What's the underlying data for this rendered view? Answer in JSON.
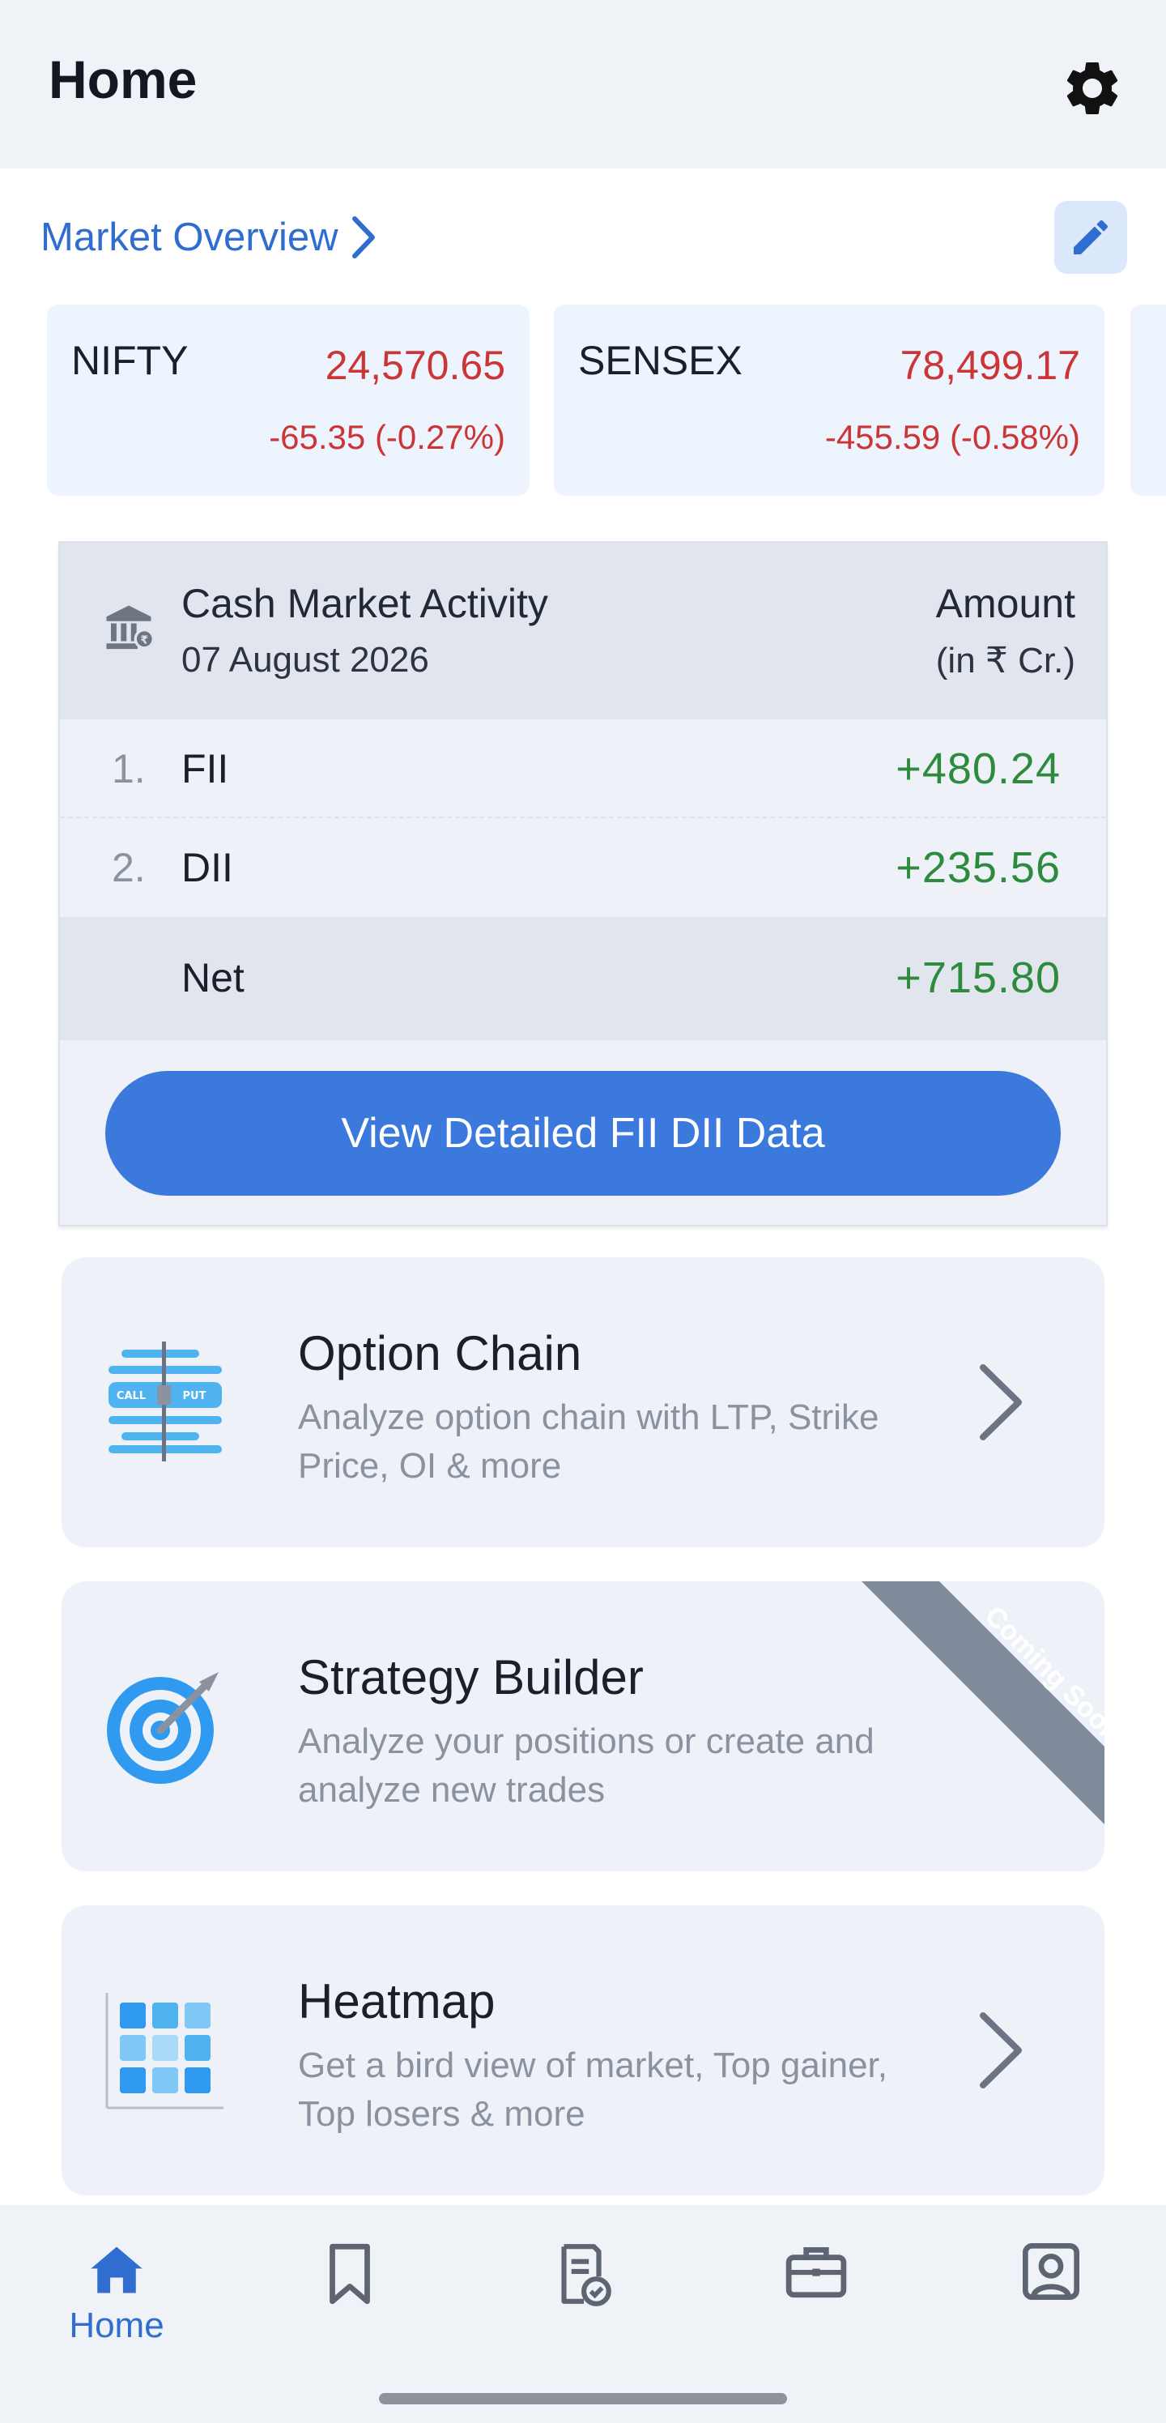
{
  "header": {
    "title": "Home",
    "settings_icon": "gear-icon"
  },
  "market_overview": {
    "label": "Market Overview",
    "edit_icon": "pencil-icon",
    "indices": [
      {
        "name": "NIFTY",
        "price": "24,570.65",
        "change": "-65.35 (-0.27%)"
      },
      {
        "name": "SENSEX",
        "price": "78,499.17",
        "change": "-455.59 (-0.58%)"
      }
    ]
  },
  "cash_market": {
    "title": "Cash Market Activity",
    "date": "07 August 2026",
    "amount_title": "Amount",
    "amount_unit": "(in ₹ Cr.)",
    "rows": [
      {
        "num": "1.",
        "label": "FII",
        "value": "+480.24"
      },
      {
        "num": "2.",
        "label": "DII",
        "value": "+235.56"
      }
    ],
    "net": {
      "label": "Net",
      "value": "+715.80"
    },
    "button_label": "View Detailed FII DII Data"
  },
  "features": [
    {
      "title": "Option Chain",
      "desc": "Analyze option chain with LTP, Strike Price, OI & more",
      "icon": "option-chain-icon",
      "icon_call": "CALL",
      "icon_put": "PUT"
    },
    {
      "title": "Strategy Builder",
      "desc": "Analyze your positions or create and analyze new trades",
      "icon": "target-icon",
      "ribbon": "Coming Soon"
    },
    {
      "title": "Heatmap",
      "desc": "Get a bird view of market, Top gainer, Top losers & more",
      "icon": "heatmap-grid-icon"
    }
  ],
  "bottom_nav": {
    "home_label": "Home",
    "icons": [
      "home-icon",
      "bookmark-icon",
      "orders-icon",
      "briefcase-icon",
      "profile-icon"
    ]
  },
  "colors": {
    "accent": "#3b79dd",
    "link": "#2f6ecf",
    "negative": "#cc3535",
    "positive": "#2e8b3e",
    "ribbon": "#7f8a9c"
  }
}
